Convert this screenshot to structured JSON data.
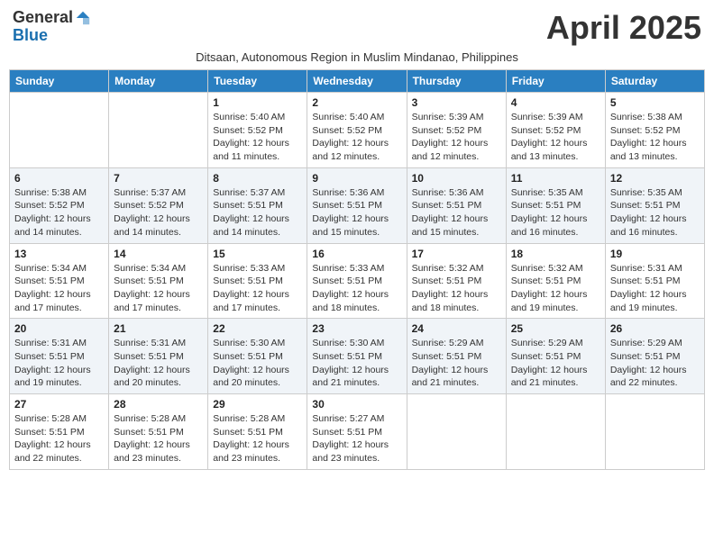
{
  "logo": {
    "general": "General",
    "blue": "Blue"
  },
  "title": "April 2025",
  "subtitle": "Ditsaan, Autonomous Region in Muslim Mindanao, Philippines",
  "weekdays": [
    "Sunday",
    "Monday",
    "Tuesday",
    "Wednesday",
    "Thursday",
    "Friday",
    "Saturday"
  ],
  "weeks": [
    [
      {
        "day": "",
        "sunrise": "",
        "sunset": "",
        "daylight": ""
      },
      {
        "day": "",
        "sunrise": "",
        "sunset": "",
        "daylight": ""
      },
      {
        "day": "1",
        "sunrise": "Sunrise: 5:40 AM",
        "sunset": "Sunset: 5:52 PM",
        "daylight": "Daylight: 12 hours and 11 minutes."
      },
      {
        "day": "2",
        "sunrise": "Sunrise: 5:40 AM",
        "sunset": "Sunset: 5:52 PM",
        "daylight": "Daylight: 12 hours and 12 minutes."
      },
      {
        "day": "3",
        "sunrise": "Sunrise: 5:39 AM",
        "sunset": "Sunset: 5:52 PM",
        "daylight": "Daylight: 12 hours and 12 minutes."
      },
      {
        "day": "4",
        "sunrise": "Sunrise: 5:39 AM",
        "sunset": "Sunset: 5:52 PM",
        "daylight": "Daylight: 12 hours and 13 minutes."
      },
      {
        "day": "5",
        "sunrise": "Sunrise: 5:38 AM",
        "sunset": "Sunset: 5:52 PM",
        "daylight": "Daylight: 12 hours and 13 minutes."
      }
    ],
    [
      {
        "day": "6",
        "sunrise": "Sunrise: 5:38 AM",
        "sunset": "Sunset: 5:52 PM",
        "daylight": "Daylight: 12 hours and 14 minutes."
      },
      {
        "day": "7",
        "sunrise": "Sunrise: 5:37 AM",
        "sunset": "Sunset: 5:52 PM",
        "daylight": "Daylight: 12 hours and 14 minutes."
      },
      {
        "day": "8",
        "sunrise": "Sunrise: 5:37 AM",
        "sunset": "Sunset: 5:51 PM",
        "daylight": "Daylight: 12 hours and 14 minutes."
      },
      {
        "day": "9",
        "sunrise": "Sunrise: 5:36 AM",
        "sunset": "Sunset: 5:51 PM",
        "daylight": "Daylight: 12 hours and 15 minutes."
      },
      {
        "day": "10",
        "sunrise": "Sunrise: 5:36 AM",
        "sunset": "Sunset: 5:51 PM",
        "daylight": "Daylight: 12 hours and 15 minutes."
      },
      {
        "day": "11",
        "sunrise": "Sunrise: 5:35 AM",
        "sunset": "Sunset: 5:51 PM",
        "daylight": "Daylight: 12 hours and 16 minutes."
      },
      {
        "day": "12",
        "sunrise": "Sunrise: 5:35 AM",
        "sunset": "Sunset: 5:51 PM",
        "daylight": "Daylight: 12 hours and 16 minutes."
      }
    ],
    [
      {
        "day": "13",
        "sunrise": "Sunrise: 5:34 AM",
        "sunset": "Sunset: 5:51 PM",
        "daylight": "Daylight: 12 hours and 17 minutes."
      },
      {
        "day": "14",
        "sunrise": "Sunrise: 5:34 AM",
        "sunset": "Sunset: 5:51 PM",
        "daylight": "Daylight: 12 hours and 17 minutes."
      },
      {
        "day": "15",
        "sunrise": "Sunrise: 5:33 AM",
        "sunset": "Sunset: 5:51 PM",
        "daylight": "Daylight: 12 hours and 17 minutes."
      },
      {
        "day": "16",
        "sunrise": "Sunrise: 5:33 AM",
        "sunset": "Sunset: 5:51 PM",
        "daylight": "Daylight: 12 hours and 18 minutes."
      },
      {
        "day": "17",
        "sunrise": "Sunrise: 5:32 AM",
        "sunset": "Sunset: 5:51 PM",
        "daylight": "Daylight: 12 hours and 18 minutes."
      },
      {
        "day": "18",
        "sunrise": "Sunrise: 5:32 AM",
        "sunset": "Sunset: 5:51 PM",
        "daylight": "Daylight: 12 hours and 19 minutes."
      },
      {
        "day": "19",
        "sunrise": "Sunrise: 5:31 AM",
        "sunset": "Sunset: 5:51 PM",
        "daylight": "Daylight: 12 hours and 19 minutes."
      }
    ],
    [
      {
        "day": "20",
        "sunrise": "Sunrise: 5:31 AM",
        "sunset": "Sunset: 5:51 PM",
        "daylight": "Daylight: 12 hours and 19 minutes."
      },
      {
        "day": "21",
        "sunrise": "Sunrise: 5:31 AM",
        "sunset": "Sunset: 5:51 PM",
        "daylight": "Daylight: 12 hours and 20 minutes."
      },
      {
        "day": "22",
        "sunrise": "Sunrise: 5:30 AM",
        "sunset": "Sunset: 5:51 PM",
        "daylight": "Daylight: 12 hours and 20 minutes."
      },
      {
        "day": "23",
        "sunrise": "Sunrise: 5:30 AM",
        "sunset": "Sunset: 5:51 PM",
        "daylight": "Daylight: 12 hours and 21 minutes."
      },
      {
        "day": "24",
        "sunrise": "Sunrise: 5:29 AM",
        "sunset": "Sunset: 5:51 PM",
        "daylight": "Daylight: 12 hours and 21 minutes."
      },
      {
        "day": "25",
        "sunrise": "Sunrise: 5:29 AM",
        "sunset": "Sunset: 5:51 PM",
        "daylight": "Daylight: 12 hours and 21 minutes."
      },
      {
        "day": "26",
        "sunrise": "Sunrise: 5:29 AM",
        "sunset": "Sunset: 5:51 PM",
        "daylight": "Daylight: 12 hours and 22 minutes."
      }
    ],
    [
      {
        "day": "27",
        "sunrise": "Sunrise: 5:28 AM",
        "sunset": "Sunset: 5:51 PM",
        "daylight": "Daylight: 12 hours and 22 minutes."
      },
      {
        "day": "28",
        "sunrise": "Sunrise: 5:28 AM",
        "sunset": "Sunset: 5:51 PM",
        "daylight": "Daylight: 12 hours and 23 minutes."
      },
      {
        "day": "29",
        "sunrise": "Sunrise: 5:28 AM",
        "sunset": "Sunset: 5:51 PM",
        "daylight": "Daylight: 12 hours and 23 minutes."
      },
      {
        "day": "30",
        "sunrise": "Sunrise: 5:27 AM",
        "sunset": "Sunset: 5:51 PM",
        "daylight": "Daylight: 12 hours and 23 minutes."
      },
      {
        "day": "",
        "sunrise": "",
        "sunset": "",
        "daylight": ""
      },
      {
        "day": "",
        "sunrise": "",
        "sunset": "",
        "daylight": ""
      },
      {
        "day": "",
        "sunrise": "",
        "sunset": "",
        "daylight": ""
      }
    ]
  ]
}
